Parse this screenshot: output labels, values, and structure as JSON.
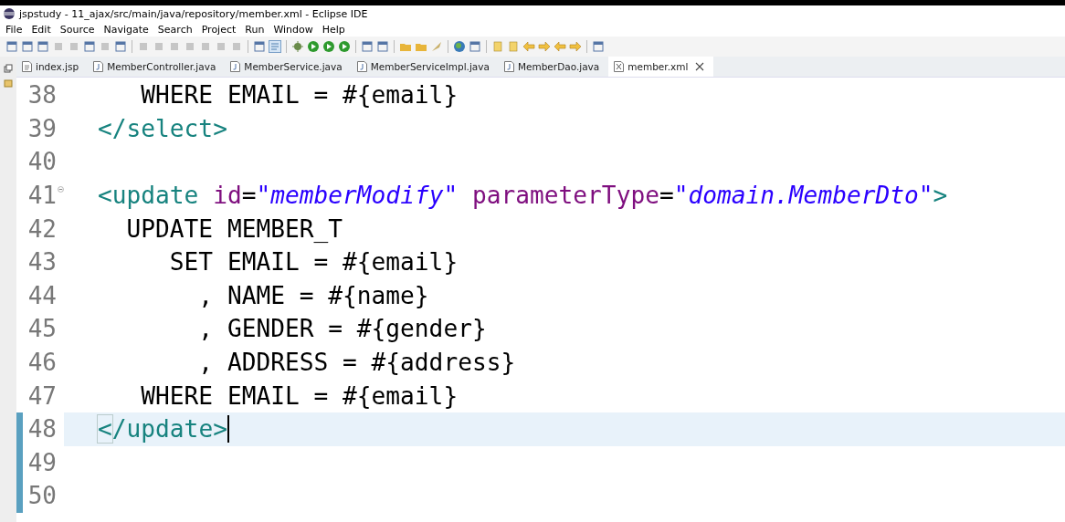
{
  "window": {
    "title": "jspstudy - 11_ajax/src/main/java/repository/member.xml - Eclipse IDE"
  },
  "menu": [
    "File",
    "Edit",
    "Source",
    "Navigate",
    "Search",
    "Project",
    "Run",
    "Window",
    "Help"
  ],
  "tabs": [
    {
      "label": "index.jsp",
      "kind": "jsp",
      "selected": false
    },
    {
      "label": "MemberController.java",
      "kind": "java",
      "selected": false
    },
    {
      "label": "MemberService.java",
      "kind": "java",
      "selected": false
    },
    {
      "label": "MemberServiceImpl.java",
      "kind": "java",
      "selected": false
    },
    {
      "label": "MemberDao.java",
      "kind": "java",
      "selected": false
    },
    {
      "label": "member.xml",
      "kind": "xml",
      "selected": true
    }
  ],
  "editor": {
    "lines": [
      {
        "number": "38",
        "current": false,
        "changed": false,
        "foldable": false,
        "tokens": [
          {
            "kind": "text",
            "text": "   WHERE EMAIL = #{email}"
          }
        ]
      },
      {
        "number": "39",
        "current": false,
        "changed": false,
        "foldable": false,
        "tokens": [
          {
            "kind": "tag",
            "text": "</select>"
          }
        ]
      },
      {
        "number": "40",
        "current": false,
        "changed": false,
        "foldable": false
      },
      {
        "number": "41",
        "current": false,
        "changed": false,
        "foldable": true,
        "tokens": [
          {
            "kind": "tag",
            "text": "<update "
          },
          {
            "kind": "attr",
            "text": "id"
          },
          {
            "kind": "text",
            "text": "="
          },
          {
            "kind": "value",
            "text": "\"memberModify\""
          },
          {
            "kind": "attr",
            "text": " parameterType"
          },
          {
            "kind": "text",
            "text": "="
          },
          {
            "kind": "value",
            "text": "\"domain.MemberDto\""
          },
          {
            "kind": "tag",
            "text": ">"
          }
        ]
      },
      {
        "number": "42",
        "current": false,
        "changed": false,
        "foldable": false,
        "tokens": [
          {
            "kind": "text",
            "text": "  UPDATE MEMBER_T"
          }
        ]
      },
      {
        "number": "43",
        "current": false,
        "changed": false,
        "foldable": false,
        "tokens": [
          {
            "kind": "text",
            "text": "     SET EMAIL = #{email}"
          }
        ]
      },
      {
        "number": "44",
        "current": false,
        "changed": false,
        "foldable": false,
        "tokens": [
          {
            "kind": "text",
            "text": "       , NAME = #{name}"
          }
        ]
      },
      {
        "number": "45",
        "current": false,
        "changed": false,
        "foldable": false,
        "tokens": [
          {
            "kind": "text",
            "text": "       , GENDER = #{gender}"
          }
        ]
      },
      {
        "number": "46",
        "current": false,
        "changed": false,
        "foldable": false,
        "tokens": [
          {
            "kind": "text",
            "text": "       , ADDRESS = #{address}"
          }
        ]
      },
      {
        "number": "47",
        "current": false,
        "changed": false,
        "foldable": false,
        "tokens": [
          {
            "kind": "text",
            "text": "   WHERE EMAIL = #{email}"
          }
        ]
      },
      {
        "number": "48",
        "current": true,
        "changed": true,
        "foldable": false,
        "tokens": [
          {
            "kind": "tag",
            "text": "</update>"
          }
        ]
      },
      {
        "number": "49",
        "current": false,
        "changed": true,
        "foldable": false
      },
      {
        "number": "50",
        "current": false,
        "changed": true,
        "foldable": false
      }
    ]
  }
}
